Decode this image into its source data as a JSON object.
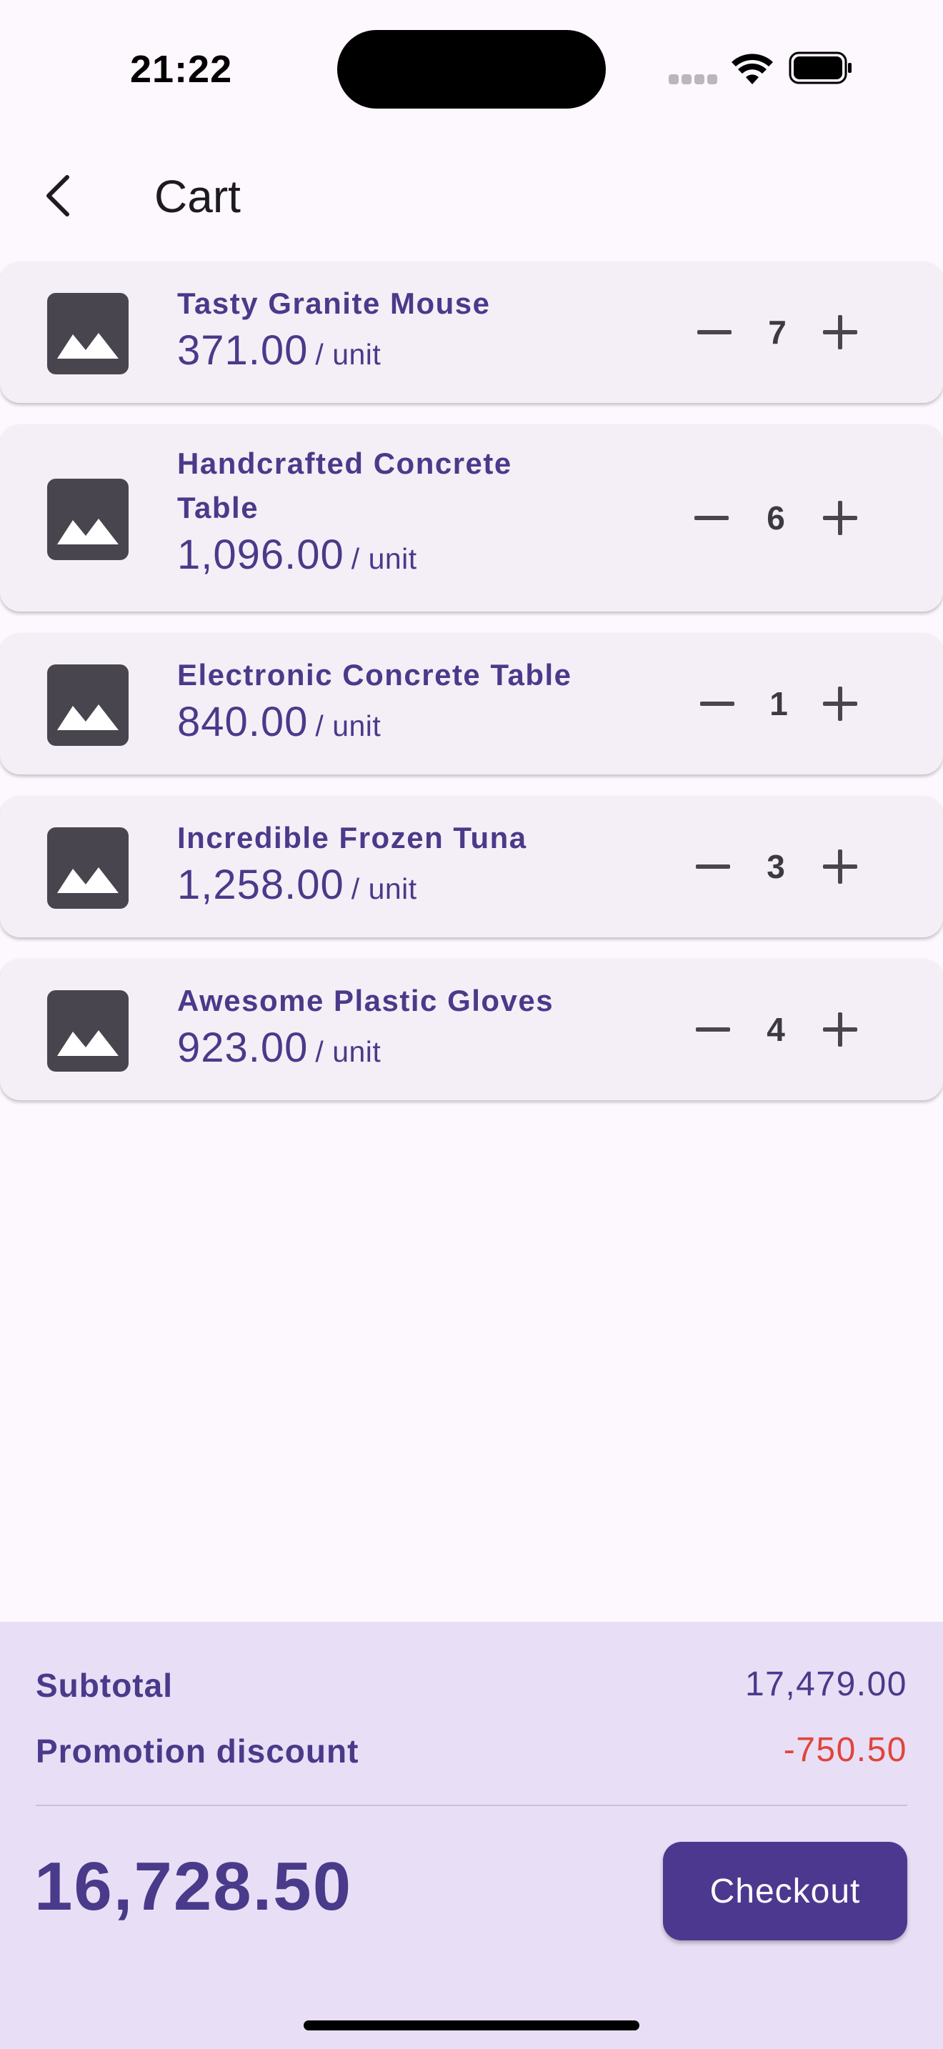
{
  "status_bar": {
    "time": "21:22",
    "icons": [
      "signal-icon",
      "wifi-icon",
      "battery-icon"
    ]
  },
  "app_bar": {
    "back_icon": "chevron-left-icon",
    "title": "Cart"
  },
  "colors": {
    "background": "#fdf7fe",
    "card": "#f4eff6",
    "accent": "#4a3a8a",
    "button": "#4d3890",
    "summary_bg": "#e8dff6",
    "discount": "#e0453b"
  },
  "items": [
    {
      "name": "Tasty Granite Mouse",
      "price": "371.00",
      "unit": "/ unit",
      "qty": "7"
    },
    {
      "name": "Handcrafted Concrete Table",
      "price": "1,096.00",
      "unit": "/ unit",
      "qty": "6"
    },
    {
      "name": "Electronic Concrete Table",
      "price": "840.00",
      "unit": "/ unit",
      "qty": "1"
    },
    {
      "name": "Incredible Frozen Tuna",
      "price": "1,258.00",
      "unit": "/ unit",
      "qty": "3"
    },
    {
      "name": "Awesome Plastic Gloves",
      "price": "923.00",
      "unit": "/ unit",
      "qty": "4"
    }
  ],
  "summary": {
    "subtotal_label": "Subtotal",
    "subtotal_value": "17,479.00",
    "discount_label": "Promotion discount",
    "discount_value": "-750.50",
    "total": "16,728.50",
    "checkout_label": "Checkout"
  }
}
